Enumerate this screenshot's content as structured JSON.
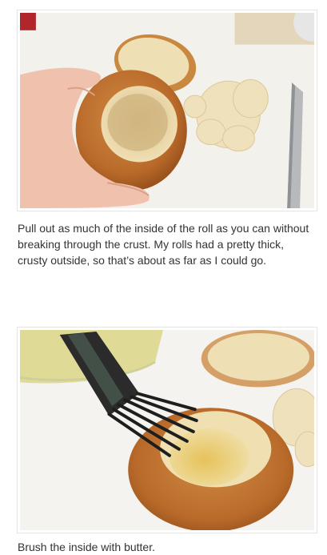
{
  "steps": [
    {
      "image_alt": "Hand holding a hollowed-out bread roll on a cutting board",
      "caption": "Pull out as much of the inside of the roll as you can without breaking through the crust. My rolls had a pretty thick, crusty outside, so that’s about as far as I could go."
    },
    {
      "image_alt": "Brushing the inside of a hollowed bread roll with melted butter",
      "caption": "Brush the inside with butter."
    }
  ],
  "colors": {
    "caption_text": "#333333",
    "frame_border": "#e6e6e6",
    "board": "#f1efe8",
    "crust": "#c47a35",
    "crumb": "#eedcae"
  }
}
